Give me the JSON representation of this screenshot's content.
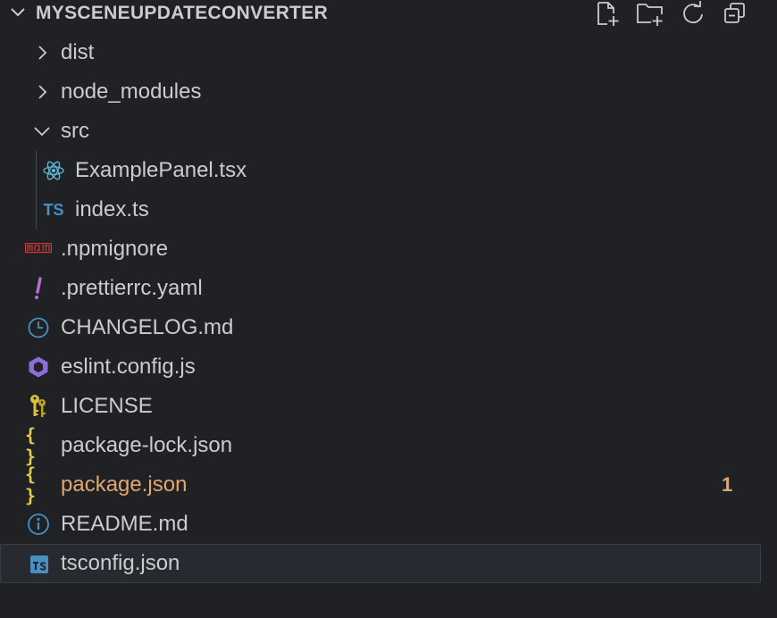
{
  "explorer": {
    "section_title": "MYSCENEUPDATECONVERTER",
    "actions": [
      {
        "name": "new-file-icon"
      },
      {
        "name": "new-folder-icon"
      },
      {
        "name": "refresh-icon"
      },
      {
        "name": "collapse-all-icon"
      }
    ]
  },
  "tree": {
    "items": [
      {
        "label": "dist",
        "type": "folder",
        "expanded": false,
        "icon": "chevron-right-icon"
      },
      {
        "label": "node_modules",
        "type": "folder",
        "expanded": false,
        "icon": "chevron-right-icon"
      },
      {
        "label": "src",
        "type": "folder",
        "expanded": true,
        "icon": "chevron-down-icon"
      },
      {
        "label": "ExamplePanel.tsx",
        "type": "file",
        "icon": "react-icon"
      },
      {
        "label": "index.ts",
        "type": "file",
        "icon": "typescript-icon",
        "icon_text": "TS"
      },
      {
        "label": ".npmignore",
        "type": "file",
        "icon": "npm-icon",
        "icon_text": "npm"
      },
      {
        "label": ".prettierrc.yaml",
        "type": "file",
        "icon": "exclamation-icon",
        "icon_text": "!"
      },
      {
        "label": "CHANGELOG.md",
        "type": "file",
        "icon": "clock-icon"
      },
      {
        "label": "eslint.config.js",
        "type": "file",
        "icon": "eslint-icon"
      },
      {
        "label": "LICENSE",
        "type": "file",
        "icon": "key-icon"
      },
      {
        "label": "package-lock.json",
        "type": "file",
        "icon": "json-braces-icon",
        "icon_text": "{ }"
      },
      {
        "label": "package.json",
        "type": "file",
        "icon": "json-braces-icon",
        "icon_text": "{ }",
        "modified": true,
        "badge": "1"
      },
      {
        "label": "README.md",
        "type": "file",
        "icon": "info-icon",
        "icon_text": "i"
      },
      {
        "label": "tsconfig.json",
        "type": "file",
        "icon": "tsconfig-icon",
        "icon_text": "TS",
        "selected": true
      }
    ]
  },
  "colors": {
    "background": "#1f2125",
    "text": "#cccccc",
    "modified": "#e2a56c",
    "selection": "#272a30",
    "typescript": "#4a8fc4",
    "react": "#5fb3d3",
    "npm": "#cb3837",
    "prettier": "#b56bd8",
    "eslint": "#8a6fd6",
    "json": "#e3c94a",
    "key": "#d8c23c"
  }
}
